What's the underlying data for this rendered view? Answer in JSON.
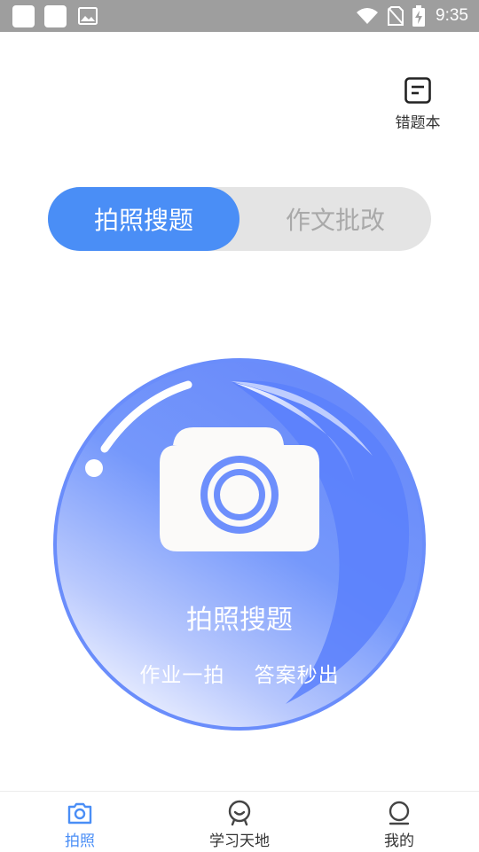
{
  "status_bar": {
    "time": "9:35",
    "icons": [
      "notification-square-icon",
      "notification-square-icon",
      "image-icon",
      "wifi-icon",
      "no-sim-icon",
      "battery-charging-icon"
    ]
  },
  "header": {
    "wrong_book_label": "错题本",
    "wrong_book_icon": "notebook-icon"
  },
  "tabs": [
    {
      "label": "拍照搜题",
      "active": true
    },
    {
      "label": "作文批改",
      "active": false
    }
  ],
  "main": {
    "title": "拍照搜题",
    "subtitle": "作业一拍    答案秒出",
    "icon": "camera-icon"
  },
  "bottom_nav": [
    {
      "label": "拍照",
      "icon": "camera-icon",
      "active": true
    },
    {
      "label": "学习天地",
      "icon": "smile-icon",
      "active": false
    },
    {
      "label": "我的",
      "icon": "person-icon",
      "active": false
    }
  ],
  "colors": {
    "accent": "#4a8ef6",
    "circle": "#6a8dfb",
    "status_bar": "#9e9e9e"
  }
}
